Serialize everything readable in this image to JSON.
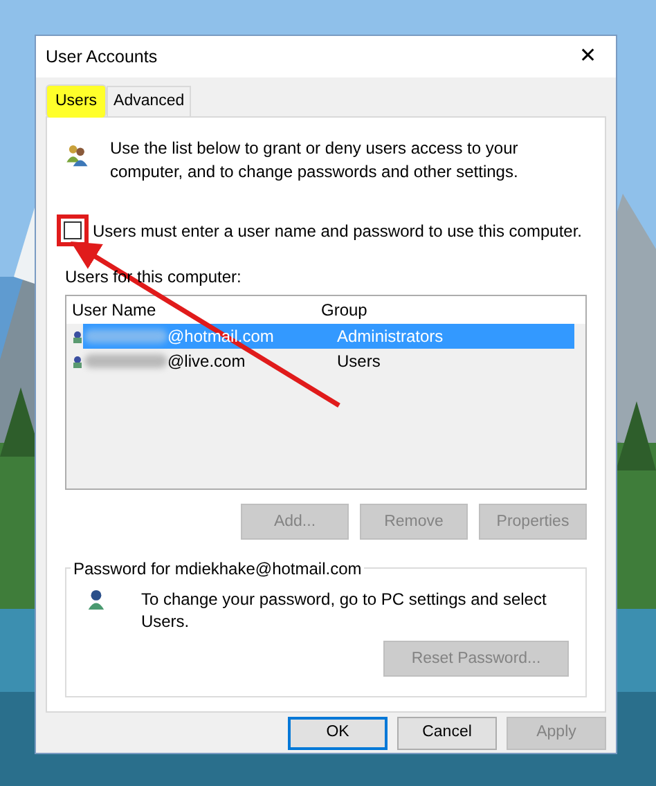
{
  "window": {
    "title": "User Accounts",
    "close": "✕"
  },
  "tabs": [
    {
      "label": "Users",
      "selected": true,
      "highlighted": true
    },
    {
      "label": "Advanced",
      "selected": false,
      "highlighted": false
    }
  ],
  "intro": "Use the list below to grant or deny users access to your computer, and to change passwords and other settings.",
  "require_login": {
    "label": "Users must enter a user name and password to use this computer.",
    "checked": false,
    "annotated": true
  },
  "users_label": "Users for this computer:",
  "users_table": {
    "columns": [
      "User Name",
      "Group"
    ],
    "rows": [
      {
        "user_name": "@hotmail.com",
        "redacted": true,
        "group": "Administrators",
        "selected": true
      },
      {
        "user_name": "@live.com",
        "redacted": true,
        "group": "Users",
        "selected": false
      }
    ]
  },
  "user_buttons": [
    {
      "label": "Add...",
      "disabled": true
    },
    {
      "label": "Remove",
      "disabled": true
    },
    {
      "label": "Properties",
      "disabled": true
    }
  ],
  "password_group": {
    "title": "Password for mdiekhake@hotmail.com",
    "text": "To change your password, go to PC settings and select Users.",
    "button": {
      "label": "Reset Password...",
      "disabled": true
    }
  },
  "footer_buttons": [
    {
      "label": "OK",
      "disabled": false,
      "default": true
    },
    {
      "label": "Cancel",
      "disabled": false,
      "default": false
    },
    {
      "label": "Apply",
      "disabled": true,
      "default": false
    }
  ],
  "annotation": {
    "arrow": true
  }
}
